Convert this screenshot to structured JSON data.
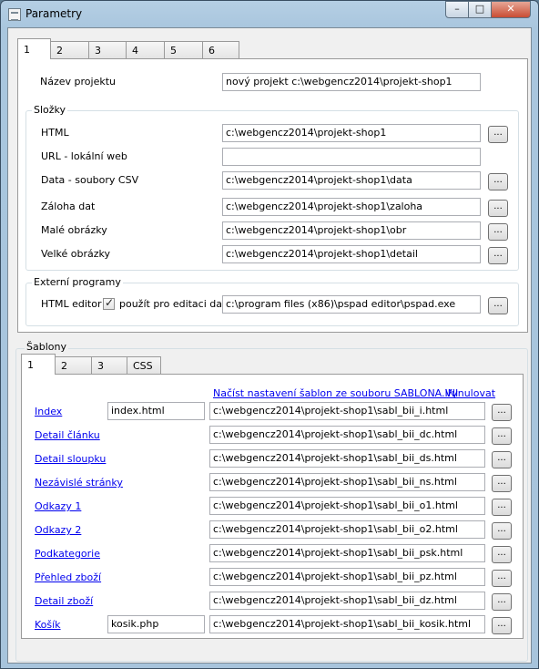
{
  "window": {
    "title": "Parametry"
  },
  "controls": {
    "minimize": "–",
    "maximize": "□",
    "close": "✕"
  },
  "top_tabs": [
    "1",
    "2",
    "3",
    "4",
    "5",
    "6"
  ],
  "project": {
    "label": "Název projektu",
    "value": "nový projekt c:\\webgencz2014\\projekt-shop1"
  },
  "folders": {
    "legend": "Složky",
    "rows": [
      {
        "label": "HTML",
        "value": "c:\\webgencz2014\\projekt-shop1",
        "button": "..."
      },
      {
        "label": "URL - lokální web",
        "value": "",
        "button": ""
      },
      {
        "label": "Data - soubory CSV",
        "value": "c:\\webgencz2014\\projekt-shop1\\data",
        "button": "..."
      },
      {
        "label": "Záloha dat",
        "value": "c:\\webgencz2014\\projekt-shop1\\zaloha",
        "button": "..."
      },
      {
        "label": "Malé obrázky",
        "value": "c:\\webgencz2014\\projekt-shop1\\obr",
        "button": "..."
      },
      {
        "label": "Velké obrázky",
        "value": "c:\\webgencz2014\\projekt-shop1\\detail",
        "button": "..."
      }
    ]
  },
  "external": {
    "legend": "Externí programy",
    "label": "HTML editor",
    "checkbox_label": "použít pro editaci dat",
    "checkbox_checked": true,
    "value": "c:\\program files (x86)\\pspad editor\\pspad.exe",
    "button": "..."
  },
  "templates": {
    "legend": "Šablony",
    "tabs": [
      "1",
      "2",
      "3",
      "CSS"
    ],
    "load_link": "Načíst nastavení šablon ze souboru SABLONA.INI",
    "reset_link": "Vynulovat",
    "rows": [
      {
        "label": "Index",
        "file": "index.html",
        "path": "c:\\webgencz2014\\projekt-shop1\\sabl_bii_i.html",
        "button": "..."
      },
      {
        "label": "Detail článku",
        "file": "",
        "path": "c:\\webgencz2014\\projekt-shop1\\sabl_bii_dc.html",
        "button": "..."
      },
      {
        "label": "Detail sloupku",
        "file": "",
        "path": "c:\\webgencz2014\\projekt-shop1\\sabl_bii_ds.html",
        "button": "..."
      },
      {
        "label": "Nezávislé stránky",
        "file": "",
        "path": "c:\\webgencz2014\\projekt-shop1\\sabl_bii_ns.html",
        "button": "..."
      },
      {
        "label": "Odkazy 1",
        "file": "",
        "path": "c:\\webgencz2014\\projekt-shop1\\sabl_bii_o1.html",
        "button": "..."
      },
      {
        "label": "Odkazy 2",
        "file": "",
        "path": "c:\\webgencz2014\\projekt-shop1\\sabl_bii_o2.html",
        "button": "..."
      },
      {
        "label": "Podkategorie",
        "file": "",
        "path": "c:\\webgencz2014\\projekt-shop1\\sabl_bii_psk.html",
        "button": "..."
      },
      {
        "label": "Přehled zboží",
        "file": "",
        "path": "c:\\webgencz2014\\projekt-shop1\\sabl_bii_pz.html",
        "button": "..."
      },
      {
        "label": "Detail zboží",
        "file": "",
        "path": "c:\\webgencz2014\\projekt-shop1\\sabl_bii_dz.html",
        "button": "..."
      },
      {
        "label": "Košík",
        "file": "kosik.php",
        "path": "c:\\webgencz2014\\projekt-shop1\\sabl_bii_kosik.html",
        "button": "..."
      }
    ]
  }
}
